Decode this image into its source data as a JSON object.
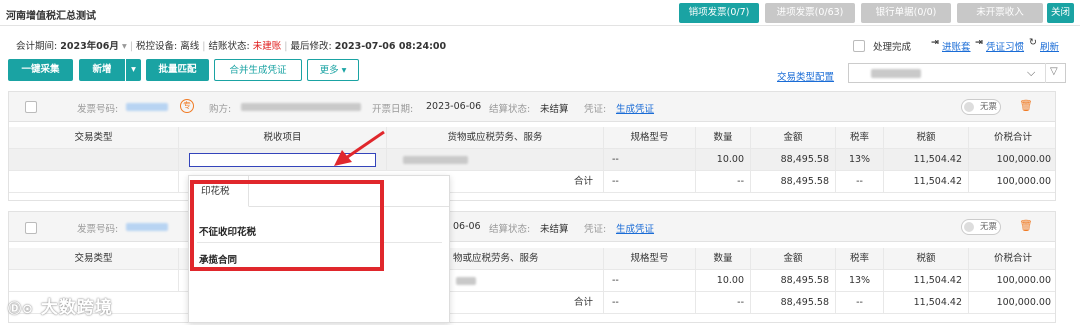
{
  "app": {
    "title": "河南增值税汇总测试"
  },
  "top_tabs": [
    {
      "label": "销项发票(0/7)"
    },
    {
      "label": "进项发票(0/63)"
    },
    {
      "label": "银行单据(0/0)"
    },
    {
      "label": "未开票收入"
    }
  ],
  "close_label": "关闭",
  "info": {
    "period_label": "会计期间:",
    "period_value": "2023年06月",
    "device_label": "税控设备:",
    "device_value": "离线",
    "status_label": "结账状态:",
    "status_value": "未建账",
    "modified_label": "最后修改:",
    "modified_value": "2023-07-06 08:24:00"
  },
  "right_controls": {
    "done_label": "处理完成",
    "account_link": "进账套",
    "voucher_link": "凭证习惯",
    "refresh_link": "刷新",
    "trade_type_link": "交易类型配置"
  },
  "toolbar": {
    "collect": "一键采集",
    "add": "新增",
    "batch_match": "批量匹配",
    "merge_voucher": "合并生成凭证",
    "more": "更多"
  },
  "invoice": {
    "no_label": "发票号码:",
    "buyer_label": "购方:",
    "date_label": "开票日期:",
    "date_value": "2023-06-06",
    "settle_label": "结算状态:",
    "settle_value": "未结算",
    "voucher_label": "凭证:",
    "voucher_link": "生成凭证",
    "special_badge": "专",
    "no_ticket": "无票"
  },
  "invoice2": {
    "date_value": "06-06"
  },
  "table": {
    "headers": [
      "交易类型",
      "税收项目",
      "货物或应税劳务、服务",
      "规格型号",
      "数量",
      "金额",
      "税率",
      "税额",
      "价税合计"
    ],
    "headers2": [
      "交易类型",
      "物或应税劳务、服务",
      "规格型号",
      "数量",
      "金额",
      "税率",
      "税额",
      "价税合计"
    ],
    "row": {
      "spec": "--",
      "qty": "10.00",
      "amount": "88,495.58",
      "rate": "13%",
      "tax": "11,504.42",
      "total": "100,000.00"
    },
    "total_row": {
      "label": "合计",
      "spec": "--",
      "qty": "--",
      "amount": "88,495.58",
      "rate": "--",
      "tax": "11,504.42",
      "total": "100,000.00"
    }
  },
  "dropdown": {
    "tab": "印花税",
    "items": [
      "不征收印花税",
      "承揽合同"
    ]
  },
  "watermark": "大数跨境",
  "colors": {
    "accent": "#1aa3a3",
    "alert": "#e0272c",
    "link": "#1a6cd6"
  }
}
